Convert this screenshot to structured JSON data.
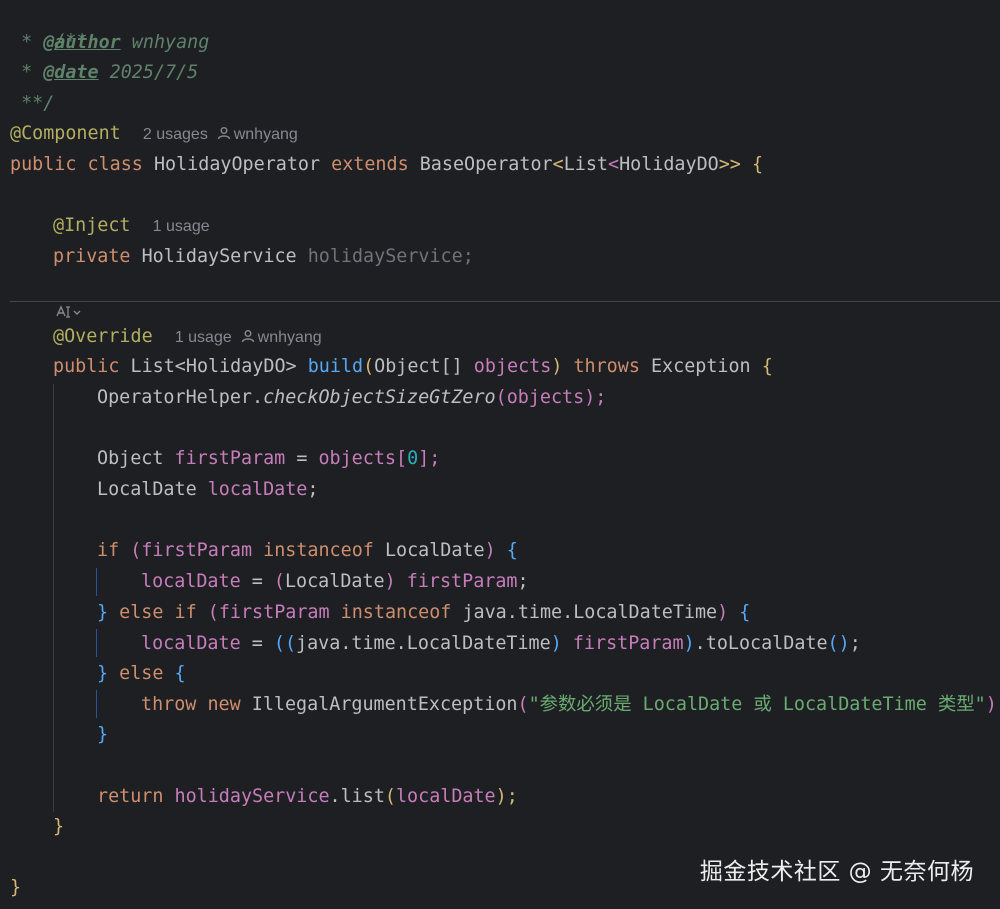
{
  "doc_comment": {
    "open": "/**",
    "author_prefix": " * ",
    "author_tag": "@author",
    "author_value": " wnhyang",
    "date_prefix": " * ",
    "date_tag": "@date",
    "date_value": " 2025/7/5",
    "close": " **/"
  },
  "class_decl": {
    "annotation": "@Component",
    "usages_hint": "2 usages",
    "author_hint": "wnhyang",
    "kw_public": "public",
    "kw_class": "class",
    "name": "HolidayOperator",
    "kw_extends": "extends",
    "super_type": "BaseOperator",
    "generic_open": "<",
    "list_type": "List",
    "generic_inner_open": "<",
    "element_type": "HolidayDO",
    "generic_close": ">>",
    "brace": "{"
  },
  "field": {
    "annotation": "@Inject",
    "usages_hint": "1 usage",
    "kw_private": "private",
    "type": "HolidayService",
    "name": "holidayService",
    "semicolon": ";"
  },
  "method": {
    "annotation": "@Override",
    "usages_hint": "1 usage",
    "author_hint": "wnhyang",
    "kw_public": "public",
    "return_type": "List<HolidayDO>",
    "name": "build",
    "paren_open": "(",
    "param_type": "Object[]",
    "param_name": "objects",
    "paren_close": ")",
    "kw_throws": "throws",
    "exception": "Exception",
    "brace": "{"
  },
  "body": {
    "helper_class": "OperatorHelper.",
    "helper_method": "checkObjectSizeGtZero",
    "helper_open": "(",
    "helper_arg": "objects",
    "helper_close": ");",
    "obj_type": "Object",
    "obj_var": "firstParam",
    "assign": " = ",
    "obj_src": "objects",
    "idx_open": "[",
    "idx": "0",
    "idx_close": "];",
    "ld_type": "LocalDate",
    "ld_var": "localDate",
    "ld_semi": ";",
    "kw_if": "if",
    "if_open": "(",
    "if_var": "firstParam",
    "kw_instanceof": "instanceof",
    "if_type": "LocalDate",
    "if_close": ")",
    "if_brace": "{",
    "a1_var": "localDate",
    "a1_eq": " = ",
    "a1_open": "(",
    "a1_type": "LocalDate",
    "a1_close": ")",
    "a1_src": "firstParam",
    "a1_semi": ";",
    "close_brace_1": "}",
    "kw_else": "else",
    "kw_if2": "if",
    "ei_open": "(",
    "ei_var": "firstParam",
    "ei_type": "java.time.LocalDateTime",
    "ei_close": ")",
    "ei_brace": "{",
    "a2_var": "localDate",
    "a2_eq": " = ",
    "a2_open": "((",
    "a2_type": "java.time.LocalDateTime",
    "a2_close": ")",
    "a2_src": "firstParam",
    "a2_paren_close": ")",
    "a2_call": ".toLocalDate",
    "a2_call_parens": "()",
    "a2_semi": ";",
    "close_brace_2": "}",
    "kw_else2": "else",
    "else_brace": "{",
    "kw_throw": "throw",
    "kw_new": "new",
    "exc_type": "IllegalArgumentException",
    "exc_open": "(",
    "exc_msg": "\"参数必须是 LocalDate 或 LocalDateTime 类型\"",
    "exc_close": ");",
    "close_brace_3": "}",
    "kw_return": "return",
    "ret_field": "holidayService",
    "ret_call": ".list",
    "ret_open": "(",
    "ret_arg": "localDate",
    "ret_close": ");",
    "method_close": "}",
    "class_close": "}"
  },
  "watermark": "掘金技术社区 @ 无奈何杨",
  "colors": {
    "background": "#1e1f22",
    "keyword": "#cf8e6d",
    "annotation": "#b3ae60",
    "field": "#c77dbb",
    "method": "#56a8f5",
    "string": "#6aab73",
    "number": "#2aacb8",
    "comment": "#5f826b",
    "default": "#bcbec4"
  },
  "icons": [
    "person-icon",
    "ai-assist-icon"
  ]
}
